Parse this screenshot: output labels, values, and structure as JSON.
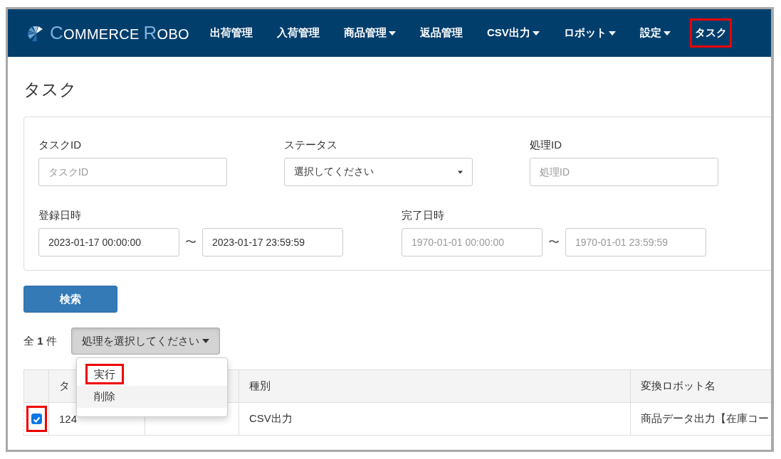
{
  "navbar": {
    "logo": "COMMERCE ROBO",
    "items": [
      {
        "label": "出荷管理",
        "has_menu": false,
        "highlighted": false
      },
      {
        "label": "入荷管理",
        "has_menu": false,
        "highlighted": false
      },
      {
        "label": "商品管理",
        "has_menu": true,
        "highlighted": false
      },
      {
        "label": "返品管理",
        "has_menu": false,
        "highlighted": false
      },
      {
        "label": "CSV出力",
        "has_menu": true,
        "highlighted": false
      },
      {
        "label": "ロボット",
        "has_menu": true,
        "highlighted": false
      },
      {
        "label": "設定",
        "has_menu": true,
        "highlighted": false
      },
      {
        "label": "タスク",
        "has_menu": false,
        "highlighted": true
      }
    ]
  },
  "page_title": "タスク",
  "filters": {
    "task_id": {
      "label": "タスクID",
      "kind": "text",
      "placeholder": "タスクID"
    },
    "status": {
      "label": "ステータス",
      "kind": "select",
      "value": "選択してください"
    },
    "process_id": {
      "label": "処理ID",
      "kind": "text",
      "placeholder": "処理ID"
    },
    "registered_at": {
      "label": "登録日時",
      "kind": "range",
      "from": {
        "value": "2023-01-17 00:00:00"
      },
      "separator": "〜",
      "to": {
        "value": "2023-01-17 23:59:59"
      }
    },
    "completed_at": {
      "label": "完了日時",
      "kind": "range",
      "from": {
        "placeholder": "1970-01-01 00:00:00"
      },
      "separator": "〜",
      "to": {
        "placeholder": "1970-01-01 23:59:59"
      }
    }
  },
  "search_button": "検索",
  "result_count": {
    "prefix": "全",
    "count": "1",
    "suffix": "件"
  },
  "action_dropdown": {
    "label": "処理を選択してください",
    "expanded": true,
    "options": [
      {
        "label": "実行",
        "highlighted": true,
        "hovered": false
      },
      {
        "label": "削除",
        "highlighted": false,
        "hovered": true
      }
    ]
  },
  "table": {
    "columns": [
      "タ",
      "",
      "種別",
      "変換ロボット名"
    ],
    "rows": [
      {
        "checked": true,
        "highlighted": true,
        "cells": [
          "124",
          "",
          "CSV出力",
          "商品データ出力【在庫コー"
        ]
      }
    ]
  }
}
